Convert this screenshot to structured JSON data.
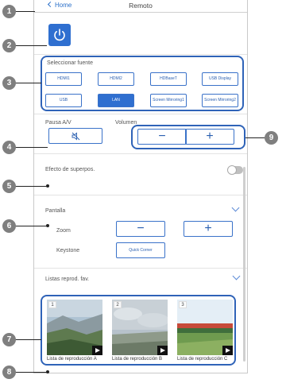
{
  "topbar": {
    "back_label": "Home",
    "title": "Remoto"
  },
  "sources": {
    "label": "Seleccionar fuente",
    "buttons": [
      "HDMI1",
      "HDMI2",
      "HDBaseT",
      "USB Display",
      "USB",
      "LAN",
      "Screen Mirroring1",
      "Screen Mirroring2"
    ],
    "active": "LAN"
  },
  "av": {
    "pause_label": "Pausa A/V",
    "volume_label": "Volumen",
    "minus": "−",
    "plus": "+"
  },
  "overlay": {
    "label": "Efecto de superpos."
  },
  "screen": {
    "label": "Pantalla",
    "zoom_label": "Zoom",
    "keystone_label": "Keystone",
    "quick_corner": "Quick Corner",
    "minus": "−",
    "plus": "+"
  },
  "playlists": {
    "label": "Listas reprod. fav.",
    "items": [
      {
        "num": "1",
        "caption": "Lista de reproducción A"
      },
      {
        "num": "2",
        "caption": "Lista de reproducción B"
      },
      {
        "num": "3",
        "caption": "Lista de reproducción C"
      }
    ]
  },
  "callouts": [
    "1",
    "2",
    "3",
    "4",
    "5",
    "6",
    "7",
    "8",
    "9"
  ],
  "colors": {
    "accent": "#2f6fd0",
    "callout": "#7f7f7f",
    "highlight": "#2f63b8"
  }
}
